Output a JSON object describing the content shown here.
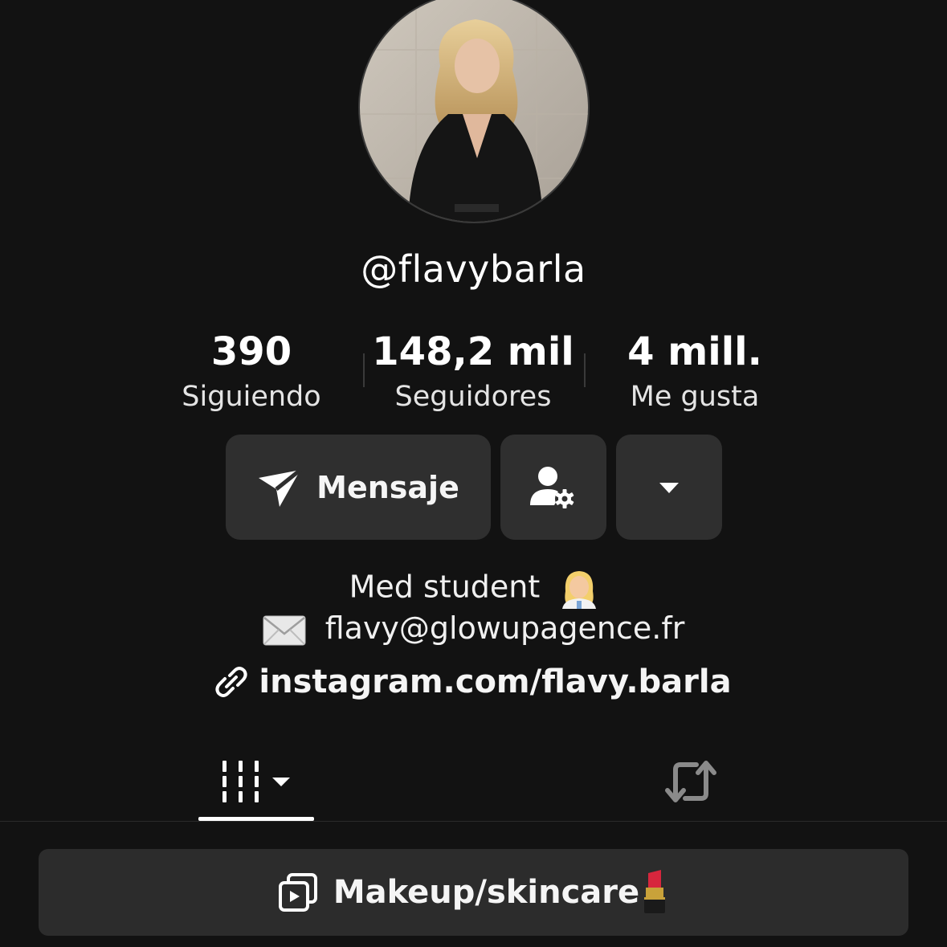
{
  "profile": {
    "username": "@flavybarla"
  },
  "stats": {
    "following_count": "390",
    "following_label": "Siguiendo",
    "followers_count": "148,2 mil",
    "followers_label": "Seguidores",
    "likes_count": "4 mill.",
    "likes_label": "Me gusta"
  },
  "actions": {
    "message_label": "Mensaje",
    "message_icon": "send-icon",
    "friend_settings_icon": "person-gear-icon",
    "more_icon": "caret-down-icon"
  },
  "bio": {
    "line1": "Med student",
    "line1_emoji": "woman-health-worker",
    "line2_emoji": "envelope",
    "line2": "flavy@glowupagence.fr",
    "link": "instagram.com/flavy.barla",
    "link_icon": "link-icon"
  },
  "tabs": {
    "videos_icon": "grid-videos-icon",
    "repost_icon": "repost-icon",
    "active": "videos"
  },
  "playlist": {
    "label": "Makeup/skincare",
    "emoji": "lipstick",
    "icon": "playlist-icon"
  },
  "colors": {
    "background": "#121212",
    "button": "#2f2f2f",
    "text": "#ffffff",
    "muted": "#e4e4e4"
  }
}
